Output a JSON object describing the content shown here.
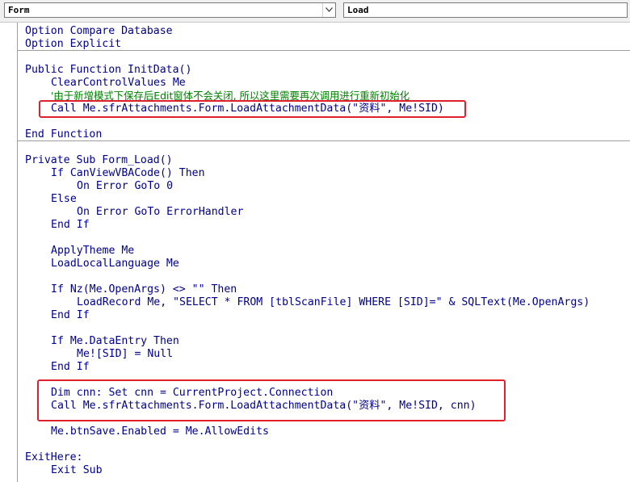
{
  "toolbar": {
    "object_combo": "Form",
    "procedure_combo": "Load"
  },
  "colors": {
    "code_text": "#00008B",
    "comment": "#008000",
    "highlight_box": "#E0202A",
    "separator": "#A0A0A0"
  },
  "code_lines": [
    {
      "text": "Option Compare Database",
      "indent": 0,
      "type": "code"
    },
    {
      "text": "Option Explicit",
      "indent": 0,
      "type": "code"
    },
    {
      "text": "",
      "indent": 0,
      "type": "blank"
    },
    {
      "text": "Public Function InitData()",
      "indent": 0,
      "type": "code"
    },
    {
      "text": "ClearControlValues Me",
      "indent": 1,
      "type": "code"
    },
    {
      "text": "'由于新增模式下保存后Edit窗体不会关闭, 所以这里需要再次调用进行重新初始化",
      "indent": 1,
      "type": "comment"
    },
    {
      "text": "Call Me.sfrAttachments.Form.LoadAttachmentData(\"资料\", Me!SID)",
      "indent": 1,
      "type": "code"
    },
    {
      "text": "",
      "indent": 0,
      "type": "blank"
    },
    {
      "text": "End Function",
      "indent": 0,
      "type": "code"
    },
    {
      "text": "",
      "indent": 0,
      "type": "blank"
    },
    {
      "text": "Private Sub Form_Load()",
      "indent": 0,
      "type": "code"
    },
    {
      "text": "If CanViewVBACode() Then",
      "indent": 1,
      "type": "code"
    },
    {
      "text": "On Error GoTo 0",
      "indent": 2,
      "type": "code"
    },
    {
      "text": "Else",
      "indent": 1,
      "type": "code"
    },
    {
      "text": "On Error GoTo ErrorHandler",
      "indent": 2,
      "type": "code"
    },
    {
      "text": "End If",
      "indent": 1,
      "type": "code"
    },
    {
      "text": "",
      "indent": 0,
      "type": "blank"
    },
    {
      "text": "ApplyTheme Me",
      "indent": 1,
      "type": "code"
    },
    {
      "text": "LoadLocalLanguage Me",
      "indent": 1,
      "type": "code"
    },
    {
      "text": "",
      "indent": 0,
      "type": "blank"
    },
    {
      "text": "If Nz(Me.OpenArgs) <> \"\" Then",
      "indent": 1,
      "type": "code"
    },
    {
      "text": "LoadRecord Me, \"SELECT * FROM [tblScanFile] WHERE [SID]=\" & SQLText(Me.OpenArgs)",
      "indent": 2,
      "type": "code"
    },
    {
      "text": "End If",
      "indent": 1,
      "type": "code"
    },
    {
      "text": "",
      "indent": 0,
      "type": "blank"
    },
    {
      "text": "If Me.DataEntry Then",
      "indent": 1,
      "type": "code"
    },
    {
      "text": "Me![SID] = Null",
      "indent": 2,
      "type": "code"
    },
    {
      "text": "End If",
      "indent": 1,
      "type": "code"
    },
    {
      "text": "",
      "indent": 0,
      "type": "blank"
    },
    {
      "text": "Dim cnn: Set cnn = CurrentProject.Connection",
      "indent": 1,
      "type": "code"
    },
    {
      "text": "Call Me.sfrAttachments.Form.LoadAttachmentData(\"资料\", Me!SID, cnn)",
      "indent": 1,
      "type": "code"
    },
    {
      "text": "",
      "indent": 0,
      "type": "blank"
    },
    {
      "text": "Me.btnSave.Enabled = Me.AllowEdits",
      "indent": 1,
      "type": "code"
    },
    {
      "text": "",
      "indent": 0,
      "type": "blank"
    },
    {
      "text": "ExitHere:",
      "indent": 0,
      "type": "code"
    },
    {
      "text": "Exit Sub",
      "indent": 1,
      "type": "code"
    }
  ]
}
